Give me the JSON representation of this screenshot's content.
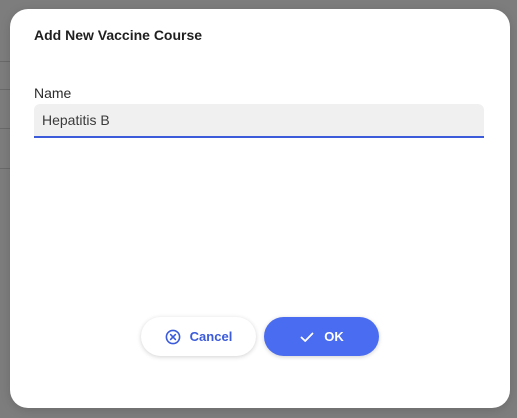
{
  "dialog": {
    "title": "Add New Vaccine Course",
    "name_field": {
      "label": "Name",
      "value": "Hepatitis B"
    },
    "buttons": {
      "cancel_label": "Cancel",
      "ok_label": "OK"
    },
    "colors": {
      "accent": "#4a6cf0",
      "accent_text": "#3b5bdb",
      "overlay": "#7d7d7d"
    },
    "icons": {
      "cancel": "x-circle-icon",
      "ok": "check-icon"
    }
  }
}
